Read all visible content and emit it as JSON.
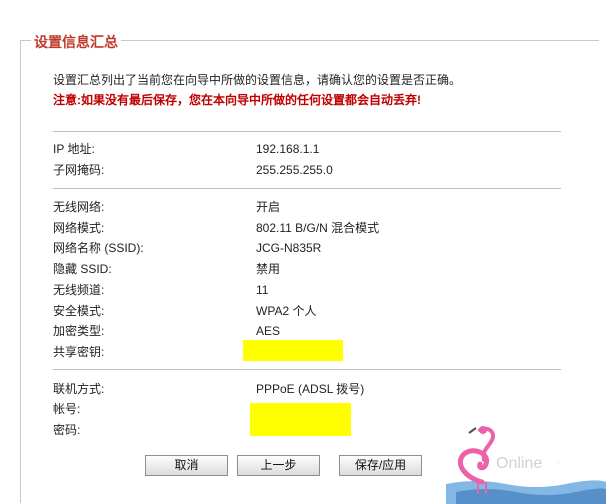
{
  "legend": "设置信息汇总",
  "intro": {
    "line1": "设置汇总列出了当前您在向导中所做的设置信息，请确认您的设置是否正确。",
    "line2_prefix": "注意:",
    "line2": "如果没有最后保存，您在本向导中所做的任何设置都会自动丢弃!"
  },
  "network": [
    {
      "label": "IP 地址:",
      "value": "192.168.1.1"
    },
    {
      "label": "子网掩码:",
      "value": "255.255.255.0"
    }
  ],
  "wireless": [
    {
      "label": "无线网络:",
      "value": "开启"
    },
    {
      "label": "网络模式:",
      "value": "802.11 B/G/N 混合模式"
    },
    {
      "label": "网络名称 (SSID):",
      "value": "JCG-N835R"
    },
    {
      "label": "隐藏 SSID:",
      "value": "禁用"
    },
    {
      "label": "无线频道:",
      "value": "11"
    },
    {
      "label": "安全模式:",
      "value": "WPA2 个人"
    },
    {
      "label": "加密类型:",
      "value": "AES"
    },
    {
      "label": "共享密钥:",
      "value": ""
    }
  ],
  "wan": [
    {
      "label": "联机方式:",
      "value": "PPPoE (ADSL 拨号)"
    },
    {
      "label": "帐号:",
      "value": ""
    },
    {
      "label": "密码:",
      "value": ""
    }
  ],
  "buttons": {
    "cancel": "取消",
    "prev": "上一步",
    "save": "保存/应用"
  },
  "colors": {
    "legend": "#c0392b",
    "warning": "#c00000",
    "redaction": "#ffff00"
  }
}
